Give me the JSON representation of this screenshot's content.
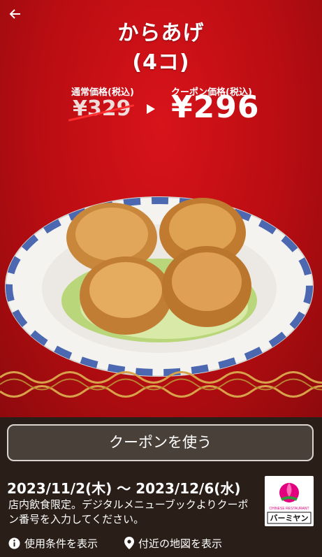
{
  "header": {
    "title_line1": "からあげ",
    "title_line2": "(4コ)"
  },
  "prices": {
    "regular_label": "通常価格(税込)",
    "regular_price": "¥329",
    "coupon_label": "クーポン価格(税込)",
    "coupon_price": "¥296"
  },
  "colors": {
    "hero_red": "#c8101a",
    "bottom_bg": "#2a1f18",
    "strike_red": "#ff2d2d",
    "logo_pink": "#e3007f"
  },
  "actions": {
    "use_coupon_label": "クーポンを使う",
    "terms_label": "使用条件を表示",
    "map_label": "付近の地図を表示"
  },
  "validity": {
    "dates": "2023/11/2(木) 〜 2023/12/6(水)",
    "description": "店内飲食限定。デジタルメニューブックよりクーポン番号を入力してください。"
  },
  "brand": {
    "logo_small_text": "CHINESE RESTAURANT",
    "logo_text": "バーミヤン"
  },
  "icons": {
    "back": "arrow-left-icon",
    "info": "info-icon",
    "location": "location-pin-icon"
  }
}
